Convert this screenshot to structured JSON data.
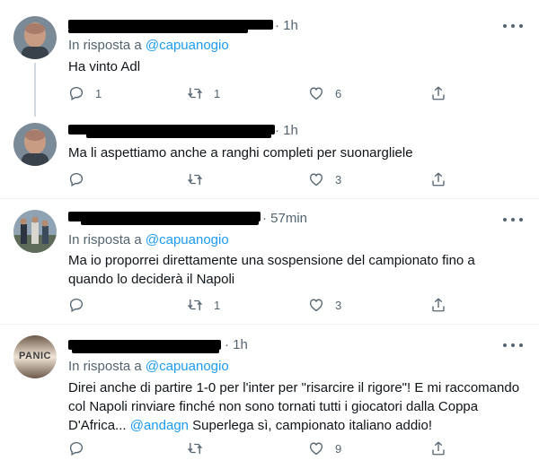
{
  "colors": {
    "accent": "#1d9bf0",
    "secondary_text": "#536471",
    "divider": "#eff3f4"
  },
  "tweets": [
    {
      "time": "· 1h",
      "reply_prefix": "In risposta a",
      "reply_handle": "@capuanogio",
      "text": "Ha vinto Adl",
      "reply_count": "1",
      "retweet_count": "1",
      "like_count": "6"
    },
    {
      "time": "· 1h",
      "text": "Ma li aspettiamo anche a ranghi completi per suonargliele",
      "reply_count": "",
      "retweet_count": "",
      "like_count": "3"
    },
    {
      "time": "· 57min",
      "reply_prefix": "In risposta a",
      "reply_handle": "@capuanogio",
      "text": "Ma io proporrei direttamente una sospensione del campionato fino a quando lo deciderà il Napoli",
      "reply_count": "",
      "retweet_count": "1",
      "like_count": "3"
    },
    {
      "time": "· 1h",
      "avatar_text": "PANIC",
      "reply_prefix": "In risposta a",
      "reply_handle": "@capuanogio",
      "text_part1": "Direi anche di partire 1-0 per l'inter per \"risarcire il rigore\"! E mi raccomando col Napoli rinviare finché non sono tornati tutti i giocatori dalla Coppa D'Africa...",
      "text_mention": "@andagn",
      "text_part2": "Superlega sì, campionato italiano addio!",
      "reply_count": "",
      "retweet_count": "",
      "like_count": "9"
    }
  ],
  "icons": [
    "reply-icon",
    "retweet-icon",
    "like-icon",
    "share-icon",
    "more-icon"
  ]
}
